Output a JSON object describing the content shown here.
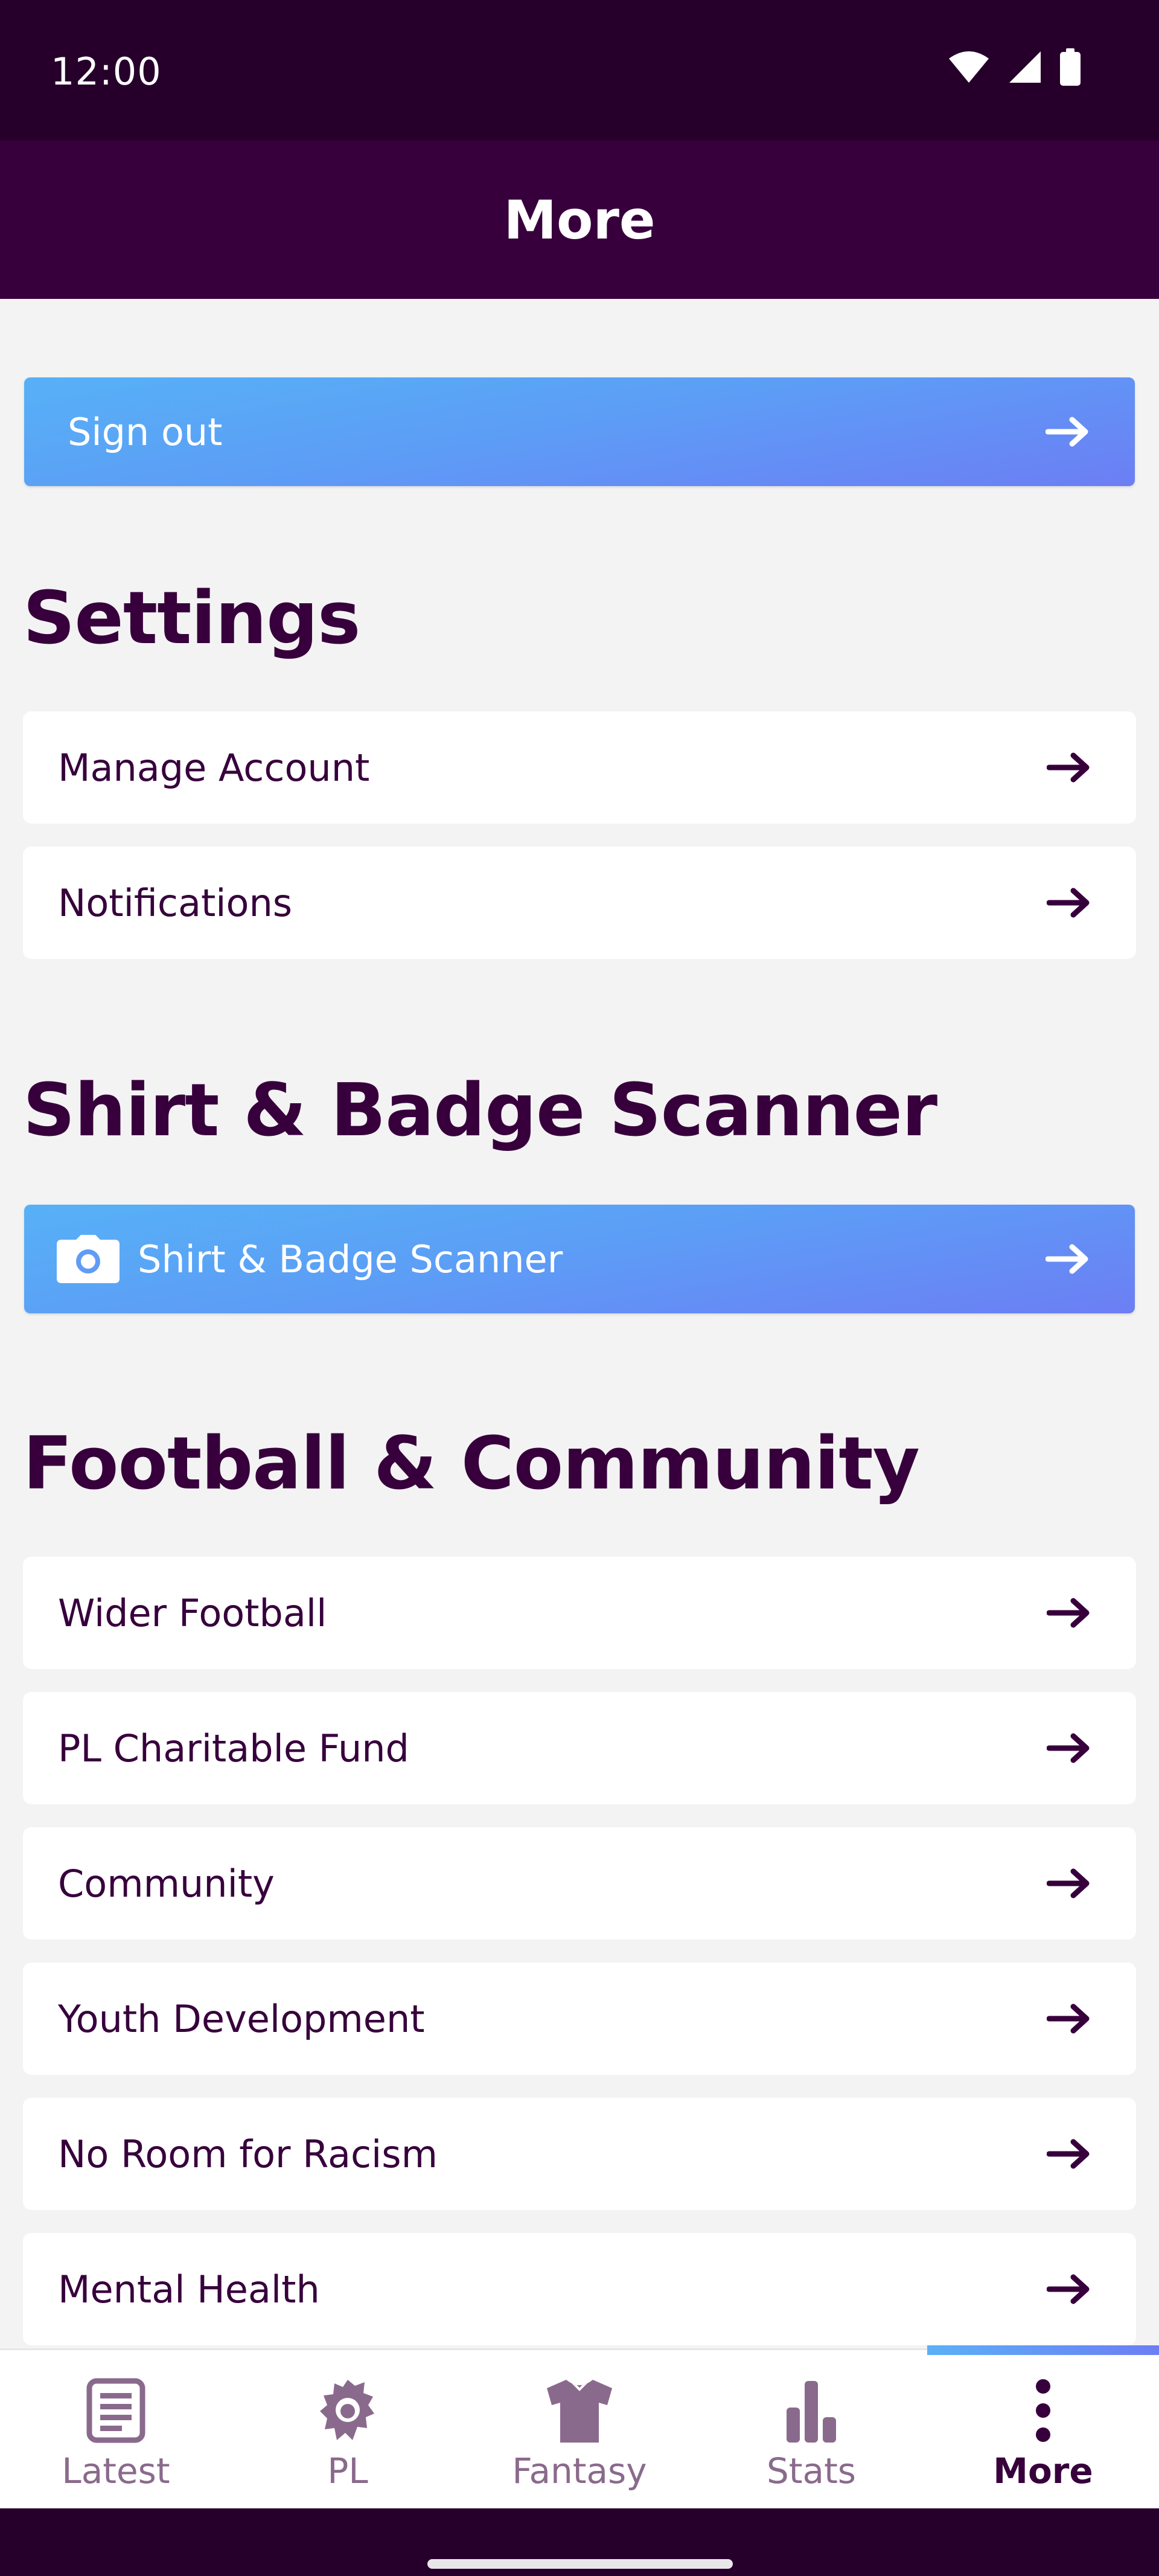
{
  "status_bar": {
    "time": "12:00"
  },
  "header": {
    "title": "More"
  },
  "sign_out": {
    "label": "Sign out"
  },
  "settings": {
    "title": "Settings",
    "items": [
      {
        "label": "Manage Account"
      },
      {
        "label": "Notifications"
      }
    ]
  },
  "scanner": {
    "title": "Shirt & Badge Scanner",
    "button_label": "Shirt & Badge Scanner"
  },
  "community": {
    "title": "Football & Community",
    "items": [
      {
        "label": "Wider Football"
      },
      {
        "label": "PL Charitable Fund"
      },
      {
        "label": "Community"
      },
      {
        "label": "Youth Development"
      },
      {
        "label": "No Room for Racism"
      },
      {
        "label": "Mental Health"
      }
    ]
  },
  "bottom_nav": {
    "active": "More",
    "items": [
      {
        "label": "Latest",
        "icon": "news-icon"
      },
      {
        "label": "PL",
        "icon": "lion-icon"
      },
      {
        "label": "Fantasy",
        "icon": "shirt-icon"
      },
      {
        "label": "Stats",
        "icon": "bar-chart-icon"
      },
      {
        "label": "More",
        "icon": "more-vertical-icon"
      }
    ]
  },
  "colors": {
    "brand_purple": "#37003c",
    "status_bar": "#26002b",
    "gradient_start": "#57b1f7",
    "gradient_end": "#6c7ef4"
  }
}
